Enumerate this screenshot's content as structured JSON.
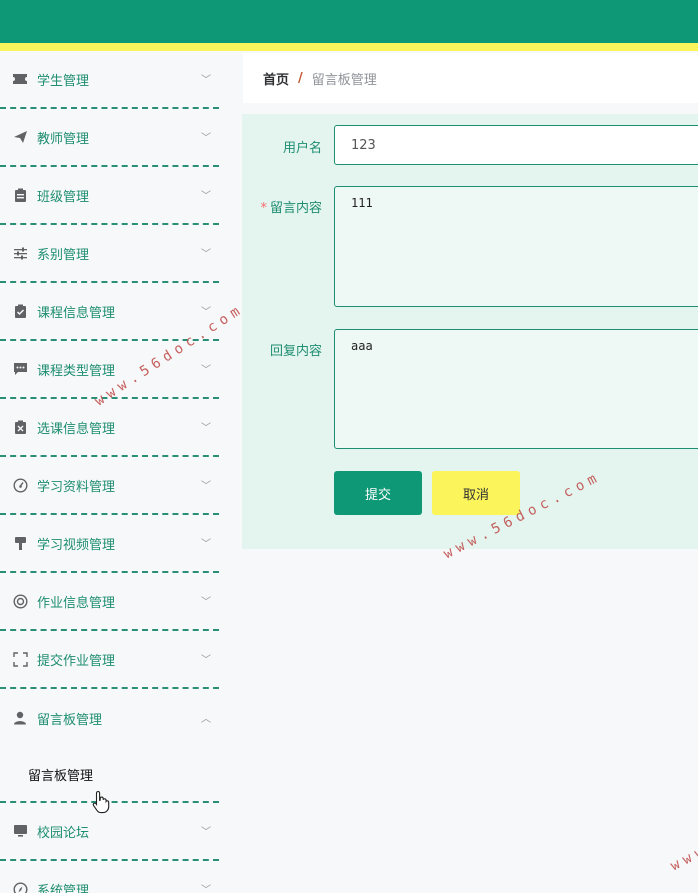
{
  "header": {
    "bar_color": "#0e9876",
    "stripe_color": "#fbf45a"
  },
  "sidebar": {
    "items": [
      {
        "label": "学生管理",
        "icon": "ticket-icon"
      },
      {
        "label": "教师管理",
        "icon": "send-icon"
      },
      {
        "label": "班级管理",
        "icon": "clipboard-icon"
      },
      {
        "label": "系别管理",
        "icon": "sliders-icon"
      },
      {
        "label": "课程信息管理",
        "icon": "checklist-icon"
      },
      {
        "label": "课程类型管理",
        "icon": "chat-icon"
      },
      {
        "label": "选课信息管理",
        "icon": "delete-doc-icon"
      },
      {
        "label": "学习资料管理",
        "icon": "gauge-icon"
      },
      {
        "label": "学习视频管理",
        "icon": "brush-icon"
      },
      {
        "label": "作业信息管理",
        "icon": "lifebuoy-icon"
      },
      {
        "label": "提交作业管理",
        "icon": "fullscreen-icon"
      },
      {
        "label": "留言板管理",
        "icon": "user-icon",
        "expanded": true
      },
      {
        "label": "校园论坛",
        "icon": "monitor-icon"
      },
      {
        "label": "系统管理",
        "icon": "compass-icon"
      }
    ],
    "submenu": {
      "label": "留言板管理"
    }
  },
  "breadcrumb": {
    "home": "首页",
    "separator": "/",
    "current": "留言板管理"
  },
  "form": {
    "username": {
      "label": "用户名",
      "value": "123"
    },
    "message": {
      "label": "留言内容",
      "required_mark": "*",
      "value": "111"
    },
    "reply": {
      "label": "回复内容",
      "value": "aaa"
    },
    "submit_label": "提交",
    "cancel_label": "取消"
  },
  "watermark": {
    "text": "www.56doc.com"
  }
}
